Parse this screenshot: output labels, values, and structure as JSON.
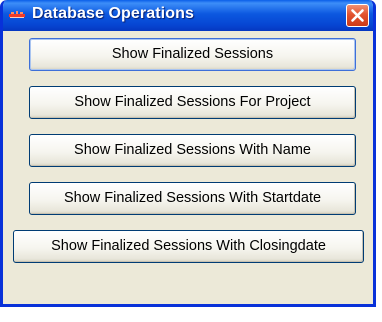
{
  "window": {
    "title": "Database Operations",
    "app_icon": "java-cup-icon",
    "close_icon": "close-icon"
  },
  "buttons": [
    {
      "label": "Show Finalized Sessions"
    },
    {
      "label": "Show Finalized Sessions For Project"
    },
    {
      "label": "Show Finalized Sessions With Name"
    },
    {
      "label": "Show Finalized Sessions With Startdate"
    },
    {
      "label": "Show Finalized Sessions With Closingdate"
    }
  ],
  "colors": {
    "titlebar": "#0646d3",
    "close_button": "#e2532f",
    "window_body": "#ece9d8",
    "button_border": "#003c74"
  }
}
